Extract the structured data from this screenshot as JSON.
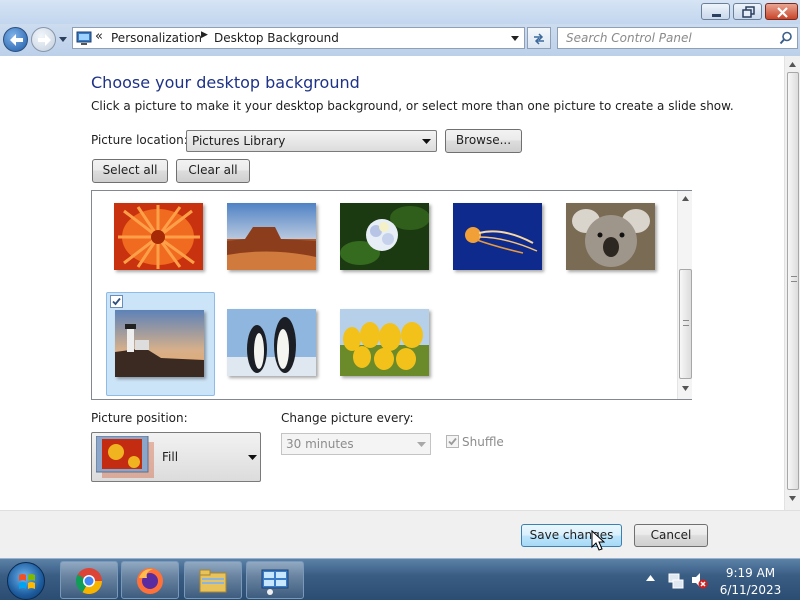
{
  "nav": {
    "crumb_sep": "«",
    "crumb1": "Personalization",
    "crumb_arrow": "▶",
    "crumb2": "Desktop Background",
    "search_placeholder": "Search Control Panel"
  },
  "main": {
    "title": "Choose your desktop background",
    "description": "Click a picture to make it your desktop background, or select more than one picture to create a slide show.",
    "location_label": "Picture location:",
    "location_value": "Pictures Library",
    "browse_label": "Browse...",
    "select_all_label": "Select all",
    "clear_all_label": "Clear all",
    "thumbnails": [
      {
        "name": "chrysanthemum",
        "selected": false
      },
      {
        "name": "desert",
        "selected": false
      },
      {
        "name": "hydrangeas",
        "selected": false
      },
      {
        "name": "jellyfish",
        "selected": false
      },
      {
        "name": "koala",
        "selected": false
      },
      {
        "name": "lighthouse",
        "selected": true
      },
      {
        "name": "penguins",
        "selected": false
      },
      {
        "name": "tulips",
        "selected": false
      }
    ],
    "position_label": "Picture position:",
    "position_value": "Fill",
    "change_label": "Change picture every:",
    "change_value": "30 minutes",
    "shuffle_label": "Shuffle",
    "shuffle_checked": true
  },
  "footer": {
    "save_label": "Save changes",
    "cancel_label": "Cancel"
  },
  "taskbar": {
    "apps": [
      "chrome",
      "firefox",
      "windows-explorer",
      "control-panel"
    ],
    "time": "9:19 AM",
    "date": "6/11/2023"
  }
}
